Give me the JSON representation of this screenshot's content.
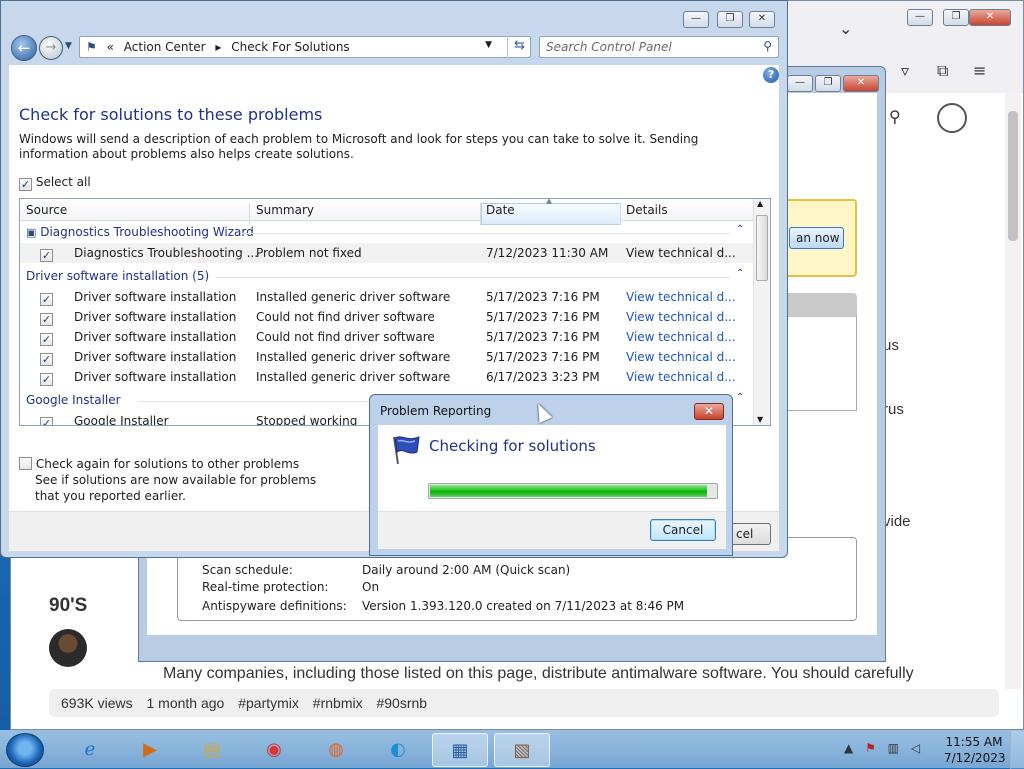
{
  "browser": {
    "side_texts": [
      "us",
      "rus",
      "vide"
    ],
    "scan_button_label": "an now",
    "video_title": "90'S",
    "views": "693K views",
    "age": "1 month ago",
    "tags": [
      "#partymix",
      "#rnbmix",
      "#90srnb"
    ],
    "body_line": "Many companies, including those listed on this page, distribute antimalware software. You should carefully"
  },
  "security": {
    "scan_schedule_label": "Scan schedule:",
    "scan_schedule_value": "Daily around 2:00 AM (Quick scan)",
    "realtime_label": "Real-time protection:",
    "realtime_value": "On",
    "antispyware_label": "Antispyware definitions:",
    "antispyware_value": "Version 1.393.120.0 created on 7/11/2023 at 8:46 PM"
  },
  "control_panel": {
    "breadcrumb": [
      "Action Center",
      "Check For Solutions"
    ],
    "breadcrumb_prefix": "«",
    "search_placeholder": "Search Control Panel",
    "heading": "Check for solutions to these problems",
    "description": "Windows will send a description of each problem to Microsoft and look for steps you can take to solve it.  Sending information about problems also helps create solutions.",
    "select_all_label": "Select all",
    "columns": [
      "Source",
      "Summary",
      "Date",
      "Details"
    ],
    "groups": [
      {
        "name": "Diagnostics Troubleshooting Wizard",
        "rows": [
          {
            "source": "Diagnostics Troubleshooting ...",
            "summary": "Problem not fixed",
            "date": "7/12/2023 11:30 AM",
            "details": "View  technical d...",
            "checked": true
          }
        ]
      },
      {
        "name": "Driver software installation (5)",
        "rows": [
          {
            "source": "Driver software installation",
            "summary": "Installed generic driver software",
            "date": "5/17/2023 7:16 PM",
            "details": "View  technical d...",
            "checked": true
          },
          {
            "source": "Driver software installation",
            "summary": "Could not find driver software",
            "date": "5/17/2023 7:16 PM",
            "details": "View  technical d...",
            "checked": true
          },
          {
            "source": "Driver software installation",
            "summary": "Could not find driver software",
            "date": "5/17/2023 7:16 PM",
            "details": "View  technical d...",
            "checked": true
          },
          {
            "source": "Driver software installation",
            "summary": "Installed generic driver software",
            "date": "5/17/2023 7:16 PM",
            "details": "View  technical d...",
            "checked": true
          },
          {
            "source": "Driver software installation",
            "summary": "Installed generic driver software",
            "date": "6/17/2023 3:23 PM",
            "details": "View  technical d...",
            "checked": true
          }
        ]
      },
      {
        "name": "Google Installer",
        "rows": [
          {
            "source": "Google Installer",
            "summary": "Stopped working",
            "date": "",
            "details": "",
            "checked": true
          }
        ]
      }
    ],
    "check_again_label": "Check again for solutions to other problems",
    "check_again_sub": "See if solutions are now available for problems that you reported earlier.",
    "cancel_partial": "cel"
  },
  "dialog": {
    "title": "Problem Reporting",
    "message": "Checking for solutions",
    "progress": 0.97,
    "cancel_label": "Cancel"
  },
  "taskbar": {
    "time": "11:55 AM",
    "date": "7/12/2023",
    "apps": [
      "internet-explorer",
      "media-player",
      "file-explorer",
      "chrome",
      "firefox",
      "edge",
      "control-panel",
      "firewall"
    ]
  },
  "colors": {
    "heading_blue": "#1e3287",
    "link_blue": "#1a56b8",
    "progress_green": "#1fc41f"
  }
}
